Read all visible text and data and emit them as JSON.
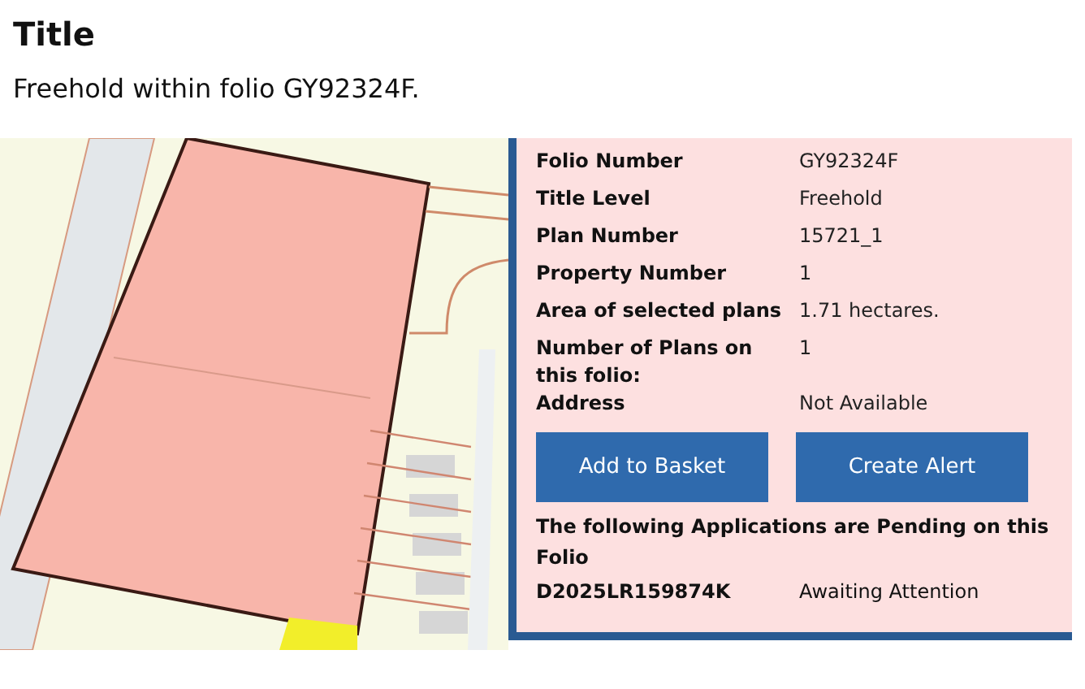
{
  "heading": "Title",
  "summary": "Freehold within folio GY92324F.",
  "details": [
    {
      "label": "Folio Number",
      "value": "GY92324F"
    },
    {
      "label": "Title Level",
      "value": "Freehold"
    },
    {
      "label": "Plan Number",
      "value": "15721_1"
    },
    {
      "label": "Property Number",
      "value": "1"
    },
    {
      "label": "Area of selected plans",
      "value": "1.71 hectares."
    },
    {
      "label": "Number of Plans on this folio:",
      "value": "1"
    },
    {
      "label": "Address",
      "value": "Not Available"
    }
  ],
  "buttons": [
    "Add to Basket",
    "Create Alert"
  ],
  "pending_note": "The following Applications are Pending on this Folio",
  "applications": [
    {
      "number": "D2025LR159874K",
      "status": "Awaiting Attention"
    }
  ]
}
